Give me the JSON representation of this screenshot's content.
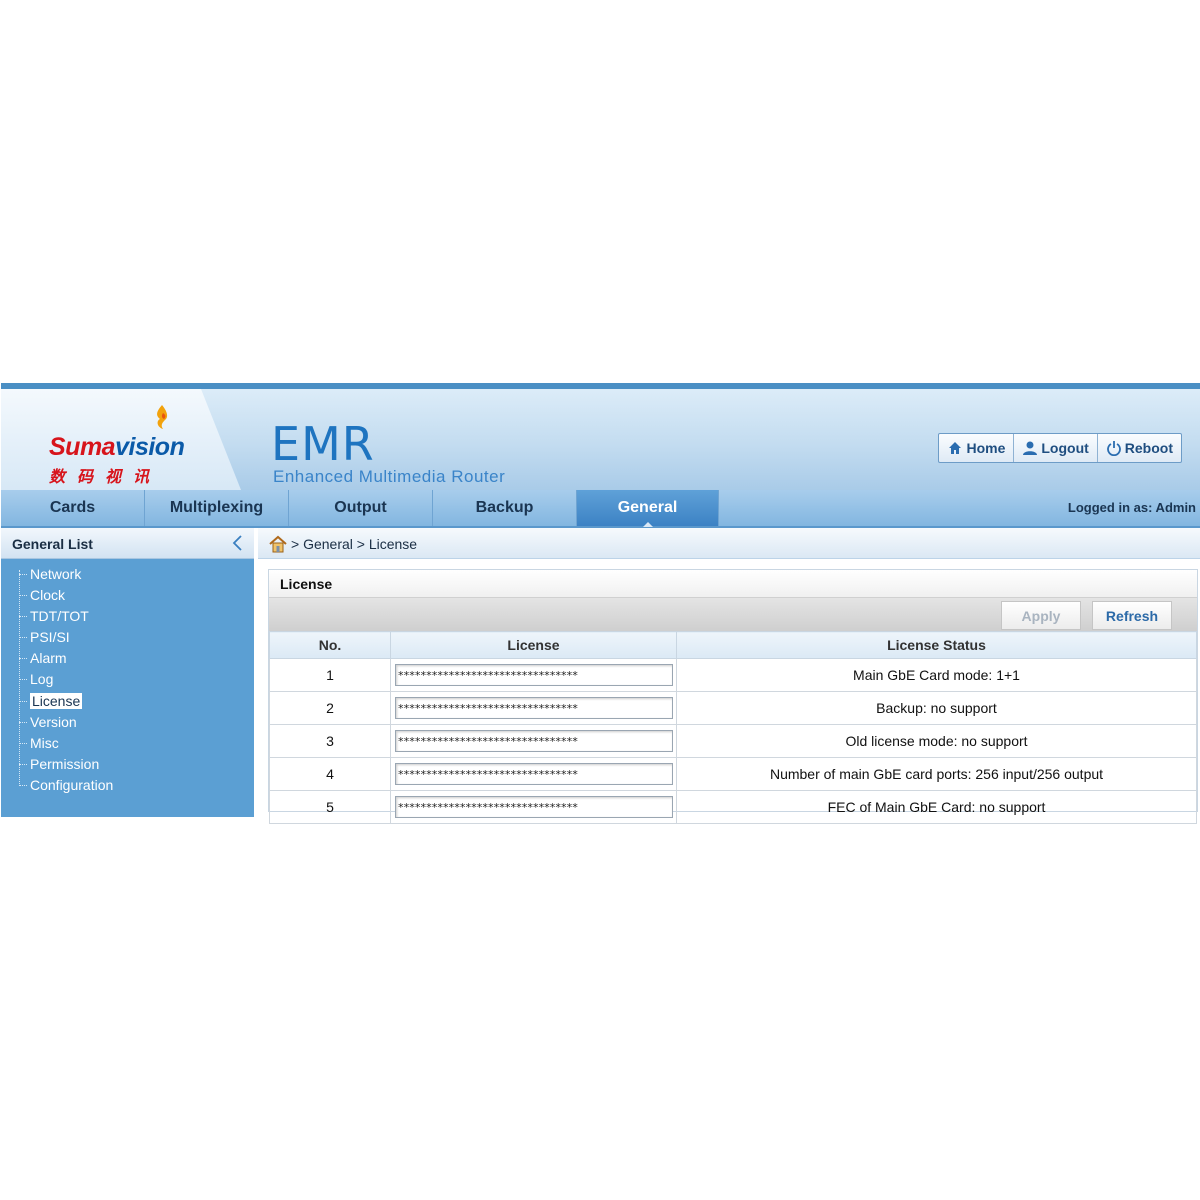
{
  "brand": {
    "logo_text_red": "Suma",
    "logo_text_blue": "vision",
    "logo_chinese": "数码视讯",
    "product": "EMR",
    "product_subtitle": "Enhanced Multimedia Router"
  },
  "header_buttons": [
    {
      "label": "Home",
      "icon": "home-icon"
    },
    {
      "label": "Logout",
      "icon": "user-icon"
    },
    {
      "label": "Reboot",
      "icon": "power-icon"
    }
  ],
  "nav": {
    "tabs": [
      {
        "label": "Cards"
      },
      {
        "label": "Multiplexing"
      },
      {
        "label": "Output"
      },
      {
        "label": "Backup"
      },
      {
        "label": "General",
        "active": true
      }
    ],
    "logged_in": "Logged in as: Admin"
  },
  "sidebar": {
    "title": "General List",
    "items": [
      {
        "label": "Network"
      },
      {
        "label": "Clock"
      },
      {
        "label": "TDT/TOT"
      },
      {
        "label": "PSI/SI"
      },
      {
        "label": "Alarm"
      },
      {
        "label": "Log"
      },
      {
        "label": "License",
        "active": true
      },
      {
        "label": "Version"
      },
      {
        "label": "Misc"
      },
      {
        "label": "Permission"
      },
      {
        "label": "Configuration"
      }
    ]
  },
  "breadcrumb": "> General > License",
  "panel": {
    "title": "License",
    "apply_label": "Apply",
    "refresh_label": "Refresh",
    "columns": [
      "No.",
      "License",
      "License Status"
    ],
    "rows": [
      {
        "no": "1",
        "license": "********************************",
        "status": "Main GbE Card mode: 1+1"
      },
      {
        "no": "2",
        "license": "********************************",
        "status": "Backup: no support"
      },
      {
        "no": "3",
        "license": "********************************",
        "status": "Old license mode: no support"
      },
      {
        "no": "4",
        "license": "********************************",
        "status": "Number of main GbE card ports: 256 input/256 output"
      },
      {
        "no": "5",
        "license": "********************************",
        "status": "FEC of Main GbE Card: no support"
      }
    ]
  },
  "colors": {
    "accent": "#3c82c4",
    "sidebar": "#5b9fd3",
    "logo_red": "#d7141b",
    "logo_blue": "#0a5aa8"
  }
}
